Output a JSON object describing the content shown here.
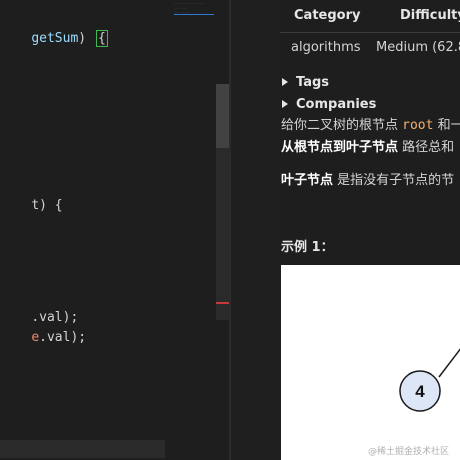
{
  "editor": {
    "lines": [
      {
        "parts": [
          {
            "t": "getSum",
            "c": "var"
          },
          {
            "t": ") ",
            "c": "plain"
          },
          {
            "t": "{",
            "c": "bracket"
          }
        ]
      },
      {
        "parts": [
          {
            "t": "t) {",
            "c": "plain"
          }
        ]
      },
      {
        "parts": [
          {
            "t": ".val);",
            "c": "plain"
          }
        ]
      },
      {
        "parts": [
          {
            "t": "e",
            "c": "red"
          },
          {
            "t": ".val);",
            "c": "plain"
          }
        ]
      }
    ]
  },
  "description": {
    "table": {
      "headers": [
        "Category",
        "Difficulty"
      ],
      "row": [
        "algorithms",
        "Medium (62.8"
      ]
    },
    "tags_label": "Tags",
    "companies_label": "Companies",
    "paragraph1": {
      "line1_prefix": "给你二叉树的根节点 ",
      "line1_code": "root",
      "line1_suffix": " 和一",
      "line2_bold": "从根节点到叶子节点",
      "line2_rest": " 路径总和"
    },
    "paragraph2": {
      "bold": "叶子节点",
      "rest": " 是指没有子节点的节"
    },
    "example_title": "示例 1：",
    "tree_node_label": "4"
  },
  "watermark": "@稀土掘金技术社区",
  "colors": {
    "node_fill": "#dce6f7",
    "node_stroke": "#1a1a1a",
    "inline_code": "#f6b26b",
    "bracket_highlight": "#3fb950"
  }
}
